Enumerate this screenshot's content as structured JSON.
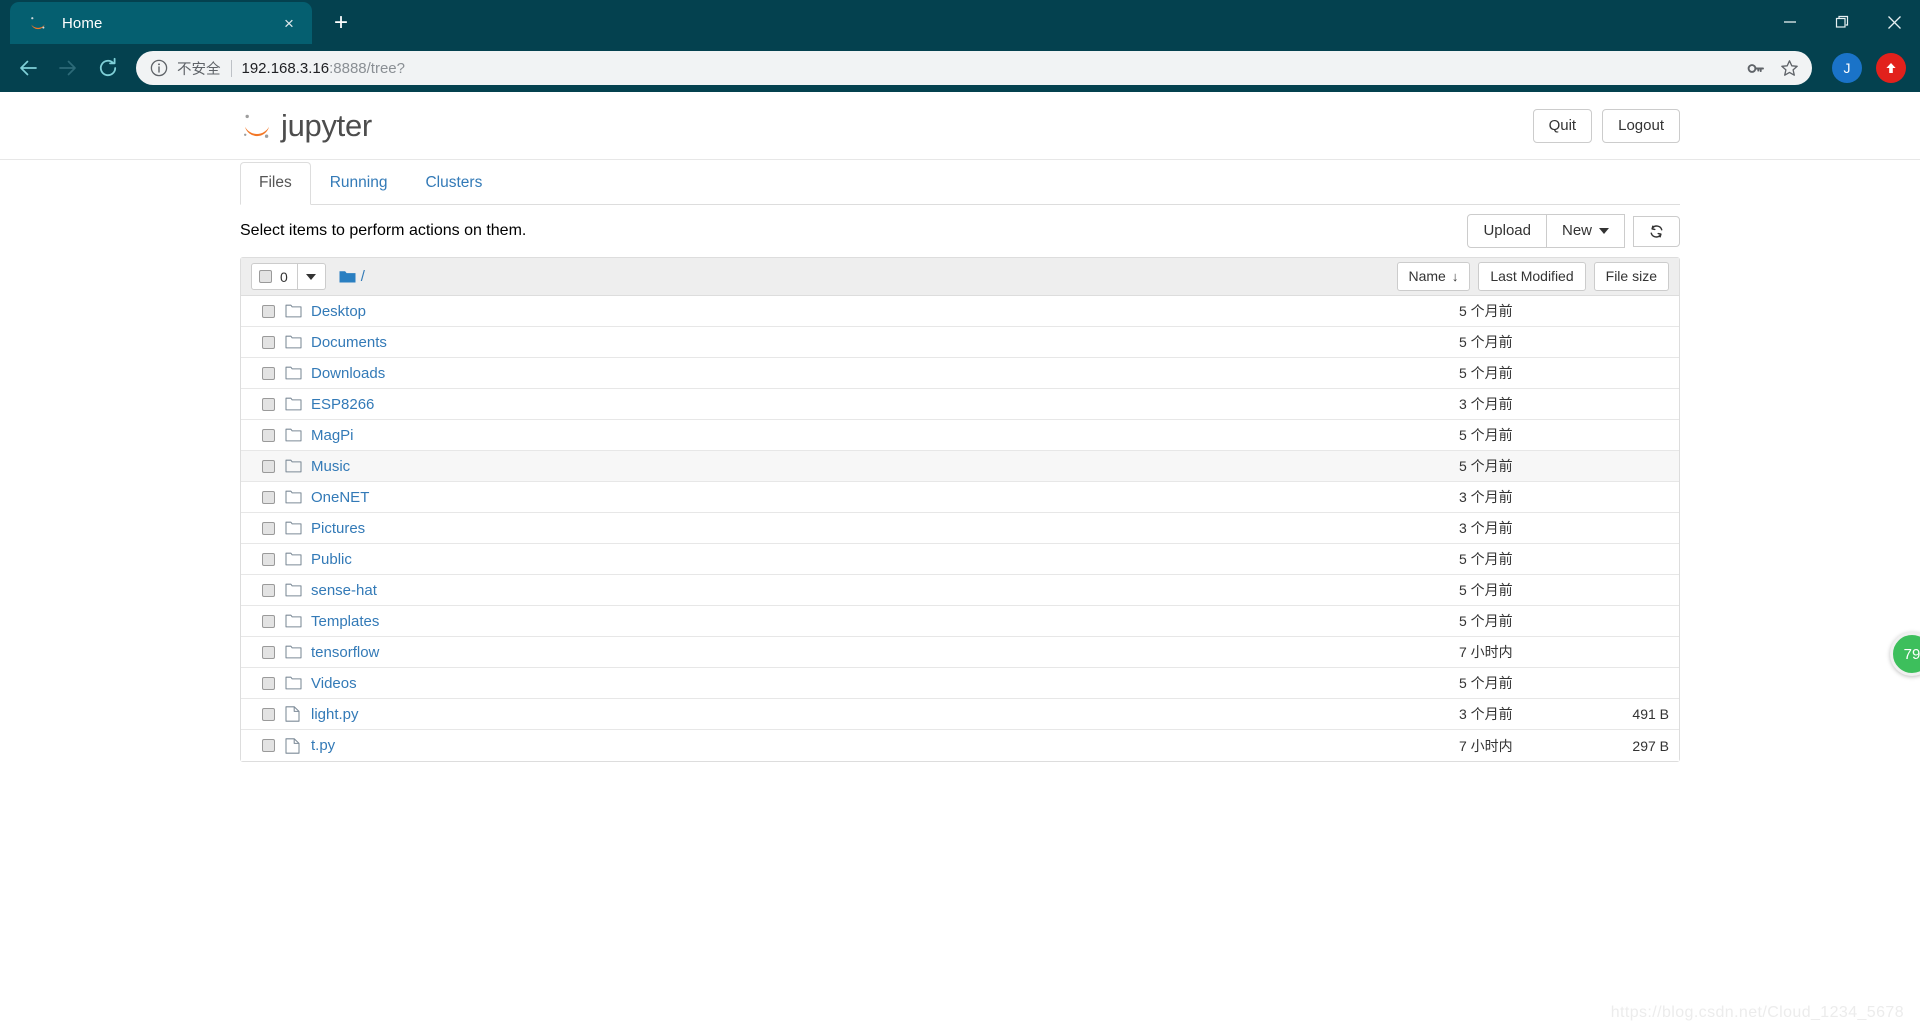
{
  "browser": {
    "tab": {
      "title": "Home",
      "favicon": "jupyter-favicon",
      "close": "×"
    },
    "new_tab": "+",
    "window_controls": {
      "minimize": "minimize-icon",
      "maximize": "maximize-icon",
      "close": "close-icon"
    },
    "nav": {
      "back": "back-arrow-icon",
      "forward": "forward-arrow-icon",
      "reload": "reload-icon"
    },
    "omnibox": {
      "security_icon": "info-circle-icon",
      "security_label": "不安全",
      "url_host": "192.168.3.16",
      "url_rest": ":8888/tree?",
      "key_icon": "key-icon",
      "star_icon": "star-icon"
    },
    "profile_initial": "J",
    "extension_icon": "red-arrow-up-icon",
    "colors": {
      "chrome_bg": "#04414f",
      "tab_bg": "#055f70",
      "accent_blue": "#337ab7"
    }
  },
  "jupyter": {
    "logo_text": "jupyter",
    "header_buttons": [
      {
        "label": "Quit",
        "name": "quit-button"
      },
      {
        "label": "Logout",
        "name": "logout-button"
      }
    ],
    "tabs": [
      {
        "label": "Files",
        "active": true
      },
      {
        "label": "Running",
        "active": false
      },
      {
        "label": "Clusters",
        "active": false
      }
    ],
    "select_hint": "Select items to perform actions on them.",
    "actions": {
      "upload": "Upload",
      "new": "New",
      "refresh_icon": "refresh-icon"
    },
    "toolbar": {
      "selected_count": "0",
      "dropdown_icon": "chevron-down-icon",
      "folder_icon": "folder-filled-icon",
      "breadcrumb_root": "/",
      "sort_name": "Name",
      "sort_name_arrow": "↓",
      "sort_modified": "Last Modified",
      "sort_filesize": "File size"
    },
    "files": [
      {
        "name": "Desktop",
        "type": "folder",
        "modified": "5 个月前",
        "size": ""
      },
      {
        "name": "Documents",
        "type": "folder",
        "modified": "5 个月前",
        "size": ""
      },
      {
        "name": "Downloads",
        "type": "folder",
        "modified": "5 个月前",
        "size": ""
      },
      {
        "name": "ESP8266",
        "type": "folder",
        "modified": "3 个月前",
        "size": ""
      },
      {
        "name": "MagPi",
        "type": "folder",
        "modified": "5 个月前",
        "size": ""
      },
      {
        "name": "Music",
        "type": "folder",
        "modified": "5 个月前",
        "size": ""
      },
      {
        "name": "OneNET",
        "type": "folder",
        "modified": "3 个月前",
        "size": ""
      },
      {
        "name": "Pictures",
        "type": "folder",
        "modified": "3 个月前",
        "size": ""
      },
      {
        "name": "Public",
        "type": "folder",
        "modified": "5 个月前",
        "size": ""
      },
      {
        "name": "sense-hat",
        "type": "folder",
        "modified": "5 个月前",
        "size": ""
      },
      {
        "name": "Templates",
        "type": "folder",
        "modified": "5 个月前",
        "size": ""
      },
      {
        "name": "tensorflow",
        "type": "folder",
        "modified": "7 小时内",
        "size": ""
      },
      {
        "name": "Videos",
        "type": "folder",
        "modified": "5 个月前",
        "size": ""
      },
      {
        "name": "light.py",
        "type": "file",
        "modified": "3 个月前",
        "size": "491 B"
      },
      {
        "name": "t.py",
        "type": "file",
        "modified": "7 小时内",
        "size": "297 B"
      }
    ]
  },
  "overlay": {
    "watermark": "https://blog.csdn.net/Cloud_1234_5678",
    "float_badge": "79"
  }
}
